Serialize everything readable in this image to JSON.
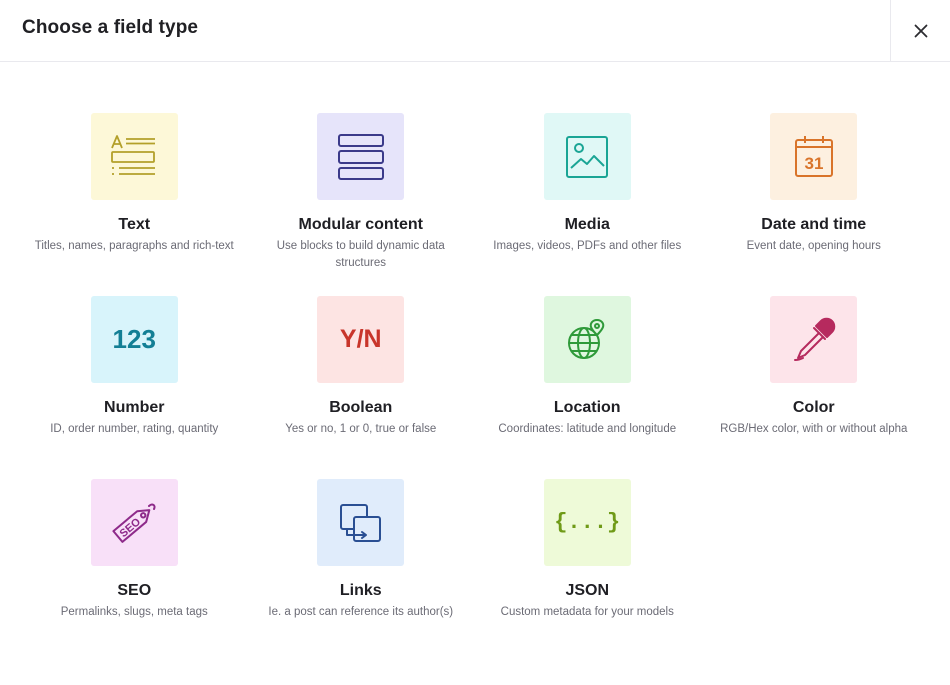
{
  "header": {
    "title": "Choose a field type",
    "close_icon": "close-icon"
  },
  "field_types": [
    {
      "key": "text",
      "title": "Text",
      "description": "Titles, names, paragraphs and rich-text",
      "icon": "text-field-icon",
      "bg": "#fdf8d8",
      "color": "#b3a02a"
    },
    {
      "key": "modular",
      "title": "Modular content",
      "description": "Use blocks to build dynamic data structures",
      "icon": "blocks-icon",
      "bg": "#e6e4fa",
      "color": "#3b3a8a"
    },
    {
      "key": "media",
      "title": "Media",
      "description": "Images, videos, PDFs and other files",
      "icon": "image-icon",
      "bg": "#e0f8f6",
      "color": "#1aa595"
    },
    {
      "key": "datetime",
      "title": "Date and time",
      "description": "Event date, opening hours",
      "icon": "calendar-icon",
      "bg": "#fdf0e0",
      "color": "#d9742a",
      "glyph": "31"
    },
    {
      "key": "number",
      "title": "Number",
      "description": "ID, order number, rating, quantity",
      "icon": "number-icon",
      "bg": "#d8f4fb",
      "color": "#137f95",
      "glyph": "123"
    },
    {
      "key": "boolean",
      "title": "Boolean",
      "description": "Yes or no, 1 or 0, true or false",
      "icon": "boolean-icon",
      "bg": "#fde4e3",
      "color": "#c8352b",
      "glyph": "Y/N"
    },
    {
      "key": "location",
      "title": "Location",
      "description": "Coordinates: latitude and longitude",
      "icon": "globe-pin-icon",
      "bg": "#dff7df",
      "color": "#2f9a3a"
    },
    {
      "key": "color",
      "title": "Color",
      "description": "RGB/Hex color, with or without alpha",
      "icon": "eyedropper-icon",
      "bg": "#fde4ea",
      "color": "#b62a5e"
    },
    {
      "key": "seo",
      "title": "SEO",
      "description": "Permalinks, slugs, meta tags",
      "icon": "seo-tag-icon",
      "bg": "#f8e0f8",
      "color": "#8e2a8a",
      "glyph": "SEO"
    },
    {
      "key": "links",
      "title": "Links",
      "description": "Ie. a post can reference its author(s)",
      "icon": "links-icon",
      "bg": "#e0ecfb",
      "color": "#2a4f93"
    },
    {
      "key": "json",
      "title": "JSON",
      "description": "Custom metadata for your models",
      "icon": "json-icon",
      "bg": "#eefad8",
      "color": "#6f9a17",
      "glyph": "{...}"
    }
  ]
}
